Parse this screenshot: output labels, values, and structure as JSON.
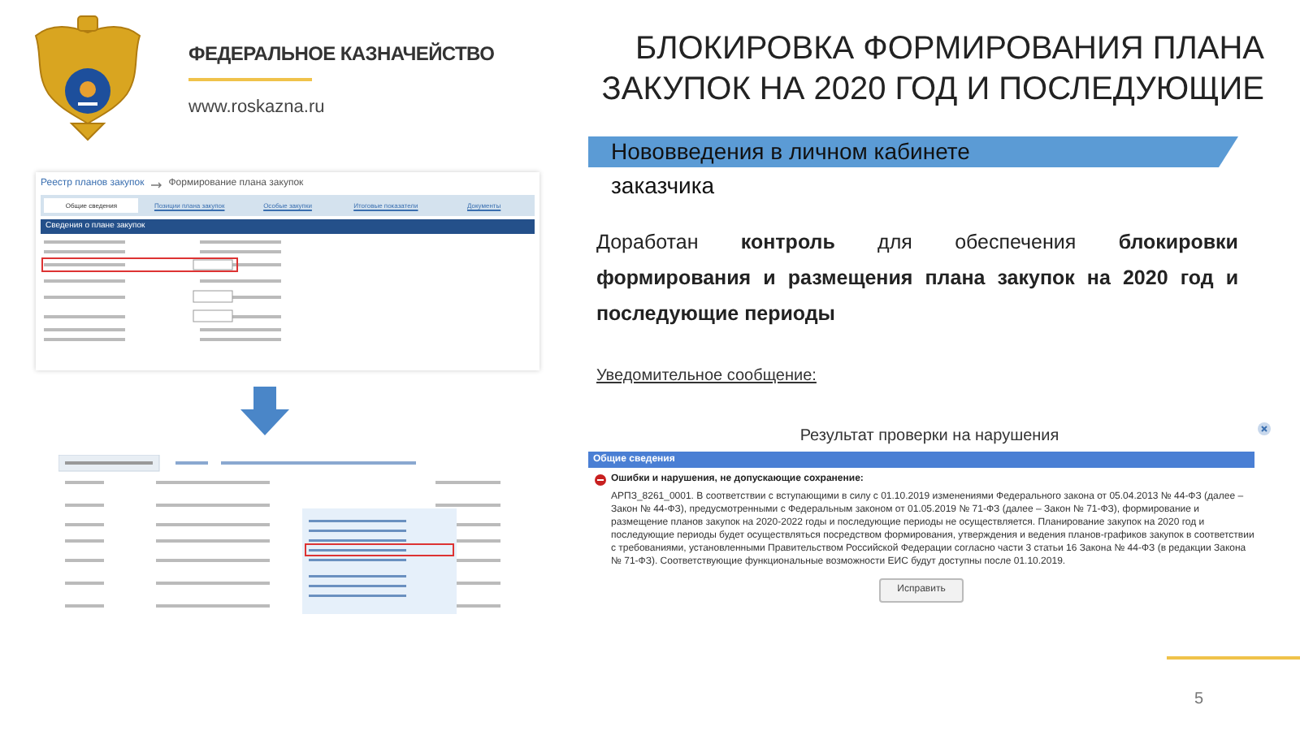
{
  "header": {
    "org_name": "ФЕДЕРАЛЬНОЕ КАЗНАЧЕЙСТВО",
    "url": "www.roskazna.ru"
  },
  "title": [
    "БЛОКИРОВКА ФОРМИРОВАНИЯ ПЛАНА",
    "ЗАКУПОК НА 2020 ГОД И ПОСЛЕДУЮЩИЕ"
  ],
  "banner": {
    "line_1": "Нововведения в личном кабинете",
    "line_2": "заказчика"
  },
  "left_screenshot": {
    "breadcrumb": "Реестр планов закупок",
    "breadcrumb_current": "Формирование плана закупок",
    "tabs": [
      {
        "label": "Общие сведения",
        "selected": true
      },
      {
        "label": "Позиции плана закупок",
        "selected": false
      },
      {
        "label": "Особые закупки",
        "selected": false
      },
      {
        "label": "Итоговые показатели",
        "selected": false
      },
      {
        "label": "Документы",
        "selected": false
      }
    ],
    "section_title": "Сведения о плане закупок"
  },
  "description": "Доработан **контроль** для обеспечения **блокировки формирования и размещения плана закупок на 2020 год и последующие периоды**",
  "notice_label": "Уведомительное сообщение:",
  "dialog": {
    "title": "Результат проверки на нарушения",
    "section": "Общие сведения",
    "error_heading": "Ошибки и нарушения, не допускающие сохранение:",
    "message": "АРПЗ_8261_0001. В соответствии с вступающими в силу с 01.10.2019 изменениями Федерального закона от 05.04.2013 № 44-ФЗ (далее – Закон № 44-ФЗ), предусмотренными с Федеральным законом от 01.05.2019 № 71-ФЗ (далее – Закон № 71-ФЗ), формирование и размещение планов закупок на 2020-2022 годы и последующие периоды не осуществляется. Планирование закупок на 2020 год и последующие периоды будет осуществляться посредством формирования, утверждения и ведения планов-графиков закупок в соответствии с требованиями, установленными Правительством Российской Федерации согласно части 3 статьи 16 Закона № 44-ФЗ (в редакции Закона № 71-ФЗ). Соответствующие функциональные возможности ЕИС будут доступны после 01.10.2019.",
    "button": "Исправить"
  },
  "page_number": "5"
}
